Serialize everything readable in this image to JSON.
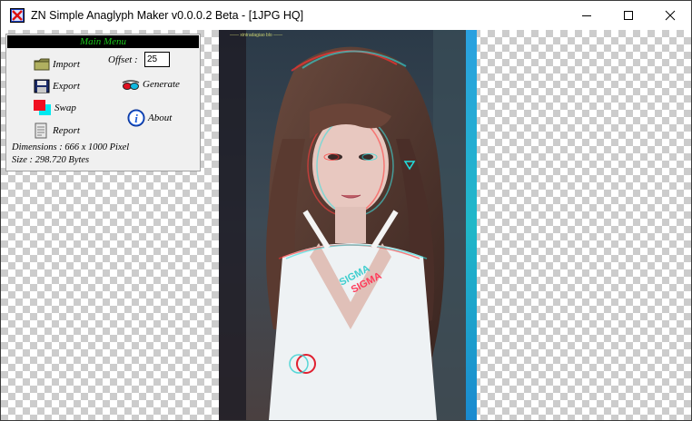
{
  "window": {
    "title": "ZN Simple Anaglyph Maker v0.0.0.2 Beta - [1JPG HQ]",
    "icon": "red-x-app-icon"
  },
  "titlebar_controls": [
    "minimize-icon",
    "maximize-icon",
    "close-icon"
  ],
  "panel": {
    "header": "Main Menu",
    "buttons": {
      "import": "Import",
      "export": "Export",
      "swap": "Swap",
      "report": "Report",
      "generate": "Generate",
      "about": "About"
    },
    "offset_label": "Offset :",
    "offset_value": "25",
    "dimensions": "Dimensions : 666 x 1000 Pixel",
    "size": "Size : 298.720 Bytes"
  },
  "image": {
    "description_icon": "anaglyph-photo",
    "watermark": "—— xintradagiao blo ——",
    "print": [
      "SIGMA",
      "SIGMA"
    ]
  },
  "colors": {
    "header_bg": "#000000",
    "header_text": "#1cc81c",
    "panel_bg": "#f0f0f0",
    "checker": "#cccccc",
    "blue_strip": "#1e9ad6"
  }
}
